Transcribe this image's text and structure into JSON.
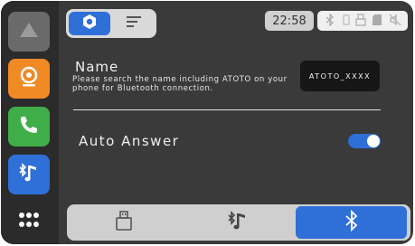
{
  "colors": {
    "accent": "#2f6fd8",
    "camera": "#f08a24",
    "phone": "#3fae49",
    "background": "#3a3a3a",
    "sidebar": "#2b2b2b"
  },
  "sidebar": {
    "items": [
      {
        "icon": "home-triangle-icon"
      },
      {
        "icon": "camera-icon"
      },
      {
        "icon": "phone-icon"
      },
      {
        "icon": "bluetooth-music-icon"
      },
      {
        "icon": "apps-grid-icon"
      }
    ]
  },
  "header": {
    "tabs": [
      {
        "icon": "gear-icon",
        "selected": true
      },
      {
        "icon": "list-icon",
        "selected": false
      }
    ],
    "clock": "22:58",
    "status_icons": [
      "bluetooth-icon",
      "usb-icon",
      "sd-card-icon",
      "mute-icon"
    ]
  },
  "bluetooth_settings": {
    "name_label": "Name",
    "name_description": "Please search the name including ATOTO on your phone for Bluetooth connection.",
    "device_name": "ATOTO_XXXX",
    "auto_answer_label": "Auto Answer",
    "auto_answer_enabled": true
  },
  "bottom_tabs": [
    {
      "icon": "usb-icon",
      "selected": false
    },
    {
      "icon": "bluetooth-music-icon",
      "selected": false
    },
    {
      "icon": "bluetooth-icon",
      "selected": true
    }
  ]
}
